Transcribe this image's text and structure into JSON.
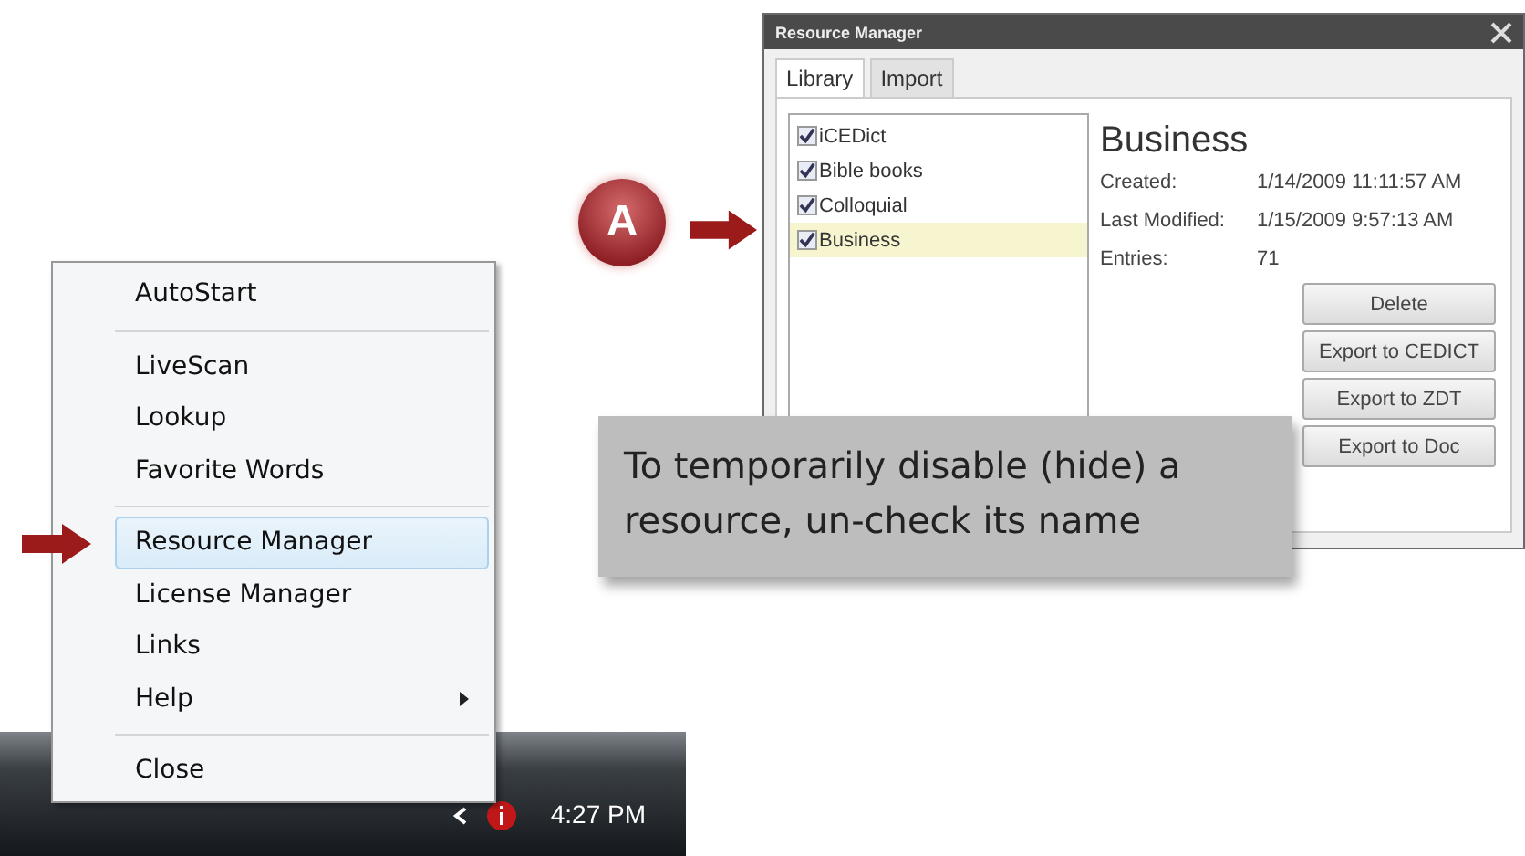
{
  "taskbar": {
    "clock": "4:27 PM"
  },
  "menu": {
    "items": [
      {
        "kind": "item",
        "label": "AutoStart",
        "selected": false
      },
      {
        "kind": "separator"
      },
      {
        "kind": "item",
        "label": "LiveScan",
        "selected": false
      },
      {
        "kind": "item",
        "label": "Lookup",
        "selected": false
      },
      {
        "kind": "item",
        "label": "Favorite Words",
        "selected": false
      },
      {
        "kind": "separator"
      },
      {
        "kind": "item",
        "label": "Resource Manager",
        "selected": true
      },
      {
        "kind": "item",
        "label": "License Manager",
        "selected": false
      },
      {
        "kind": "item",
        "label": "Links",
        "selected": false
      },
      {
        "kind": "item",
        "label": "Help",
        "selected": false,
        "submenu": true
      },
      {
        "kind": "separator"
      },
      {
        "kind": "item",
        "label": "Close",
        "selected": false
      }
    ]
  },
  "badge": {
    "label": "A"
  },
  "window": {
    "title": "Resource Manager",
    "tabs": [
      {
        "label": "Library",
        "selected": true
      },
      {
        "label": "Import",
        "selected": false
      }
    ],
    "resources": [
      {
        "name": "iCEDict",
        "checked": true,
        "selected": false
      },
      {
        "name": "Bible books",
        "checked": true,
        "selected": false
      },
      {
        "name": "Colloquial",
        "checked": true,
        "selected": false
      },
      {
        "name": "Business",
        "checked": true,
        "selected": true
      }
    ],
    "detail": {
      "title": "Business",
      "fields": [
        {
          "label": "Created:",
          "value": "1/14/2009 11:11:57 AM"
        },
        {
          "label": "Last Modified:",
          "value": "1/15/2009 9:57:13 AM"
        },
        {
          "label": "Entries:",
          "value": "71"
        }
      ]
    },
    "buttons": [
      "Delete",
      "Export to CEDICT",
      "Export to ZDT",
      "Export to Doc"
    ]
  },
  "callout": {
    "text": "To temporarily disable (hide) a resource, un-check its name"
  }
}
